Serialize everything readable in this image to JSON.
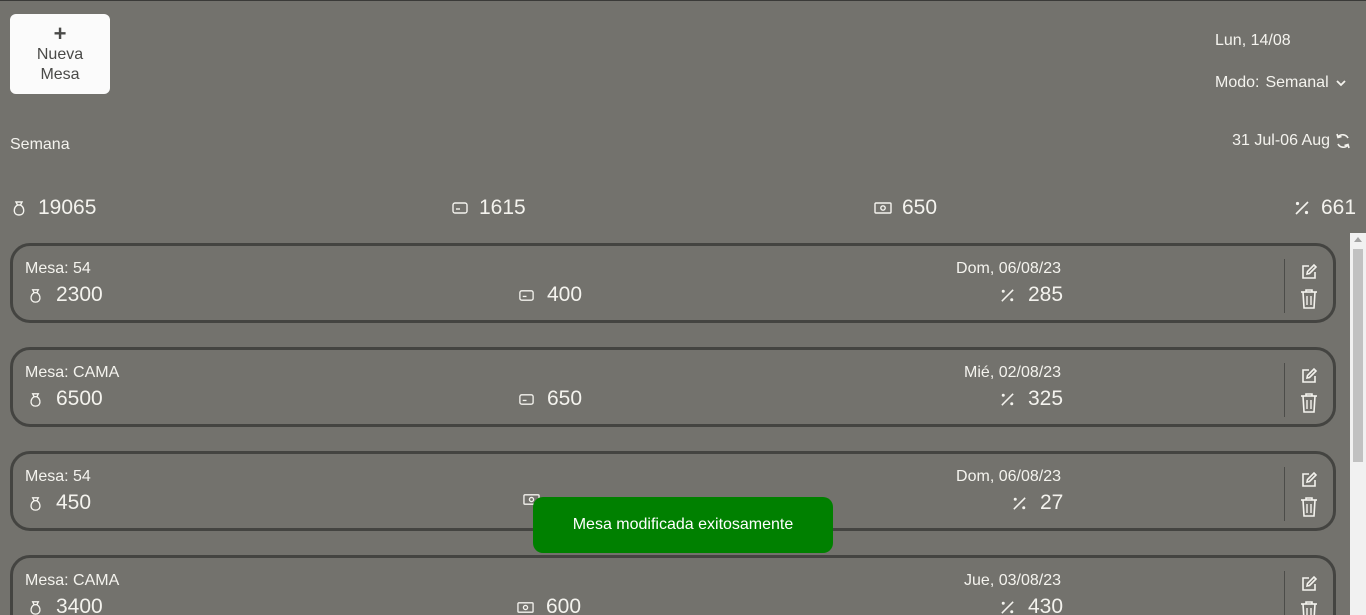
{
  "new_button": {
    "plus": "+",
    "label_line1": "Nueva",
    "label_line2": "Mesa"
  },
  "header": {
    "date": "Lun, 14/08",
    "mode_label": "Modo:",
    "mode_value": "Semanal"
  },
  "week": {
    "label": "Semana",
    "range": "31 Jul-06 Aug"
  },
  "totals": {
    "bag": "19065",
    "card": "1615",
    "cash": "650",
    "percent": "661"
  },
  "mesas": [
    {
      "mesa": "Mesa: 54",
      "date": "Dom, 06/08/23",
      "amount": "2300",
      "payment_type": "card",
      "payment": "400",
      "percent": "285"
    },
    {
      "mesa": "Mesa: CAMA",
      "date": "Mié, 02/08/23",
      "amount": "6500",
      "payment_type": "card",
      "payment": "650",
      "percent": "325"
    },
    {
      "mesa": "Mesa: 54",
      "date": "Dom, 06/08/23",
      "amount": "450",
      "payment_type": "cash",
      "payment": "",
      "percent": "27"
    },
    {
      "mesa": "Mesa: CAMA",
      "date": "Jue, 03/08/23",
      "amount": "3400",
      "payment_type": "cash",
      "payment": "600",
      "percent": "430"
    }
  ],
  "toast": {
    "message": "Mesa modificada exitosamente"
  },
  "colors": {
    "background": "#73726d",
    "toast": "#008000",
    "card_border": "#444441"
  }
}
